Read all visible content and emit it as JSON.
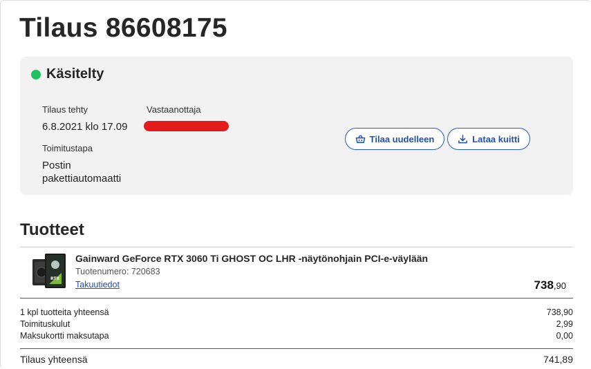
{
  "order": {
    "title": "Tilaus 86608175",
    "status": "Käsitelty",
    "status_color": "#1ec063",
    "ordered_label": "Tilaus tehty",
    "ordered_value": "6.8.2021 klo 17.09",
    "recipient_label": "Vastaanottaja",
    "delivery_label": "Toimitustapa",
    "delivery_value_line1": "Postin",
    "delivery_value_line2": "pakettiautomaatti"
  },
  "actions": {
    "reorder_label": "Tilaa uudelleen",
    "reorder_icon": "basket-icon",
    "receipt_label": "Lataa kuitti",
    "receipt_icon": "download-icon"
  },
  "products": {
    "heading": "Tuotteet",
    "items": [
      {
        "name": "Gainward GeForce RTX 3060 Ti GHOST OC LHR -näytönohjain PCI-e-väylään",
        "product_number": "Tuotenumero: 720683",
        "warranty_link": "Takuutiedot",
        "price_whole": "738",
        "price_cents": ",90"
      }
    ]
  },
  "summary": {
    "rows": [
      {
        "label": "1 kpl tuotteita yhteensä",
        "value": "738,90"
      },
      {
        "label": "Toimituskulut",
        "value": "2,99"
      },
      {
        "label": "Maksukortti maksutapa",
        "value": "0,00"
      }
    ],
    "total_label": "Tilaus yhteensä",
    "total_value": "741,89"
  },
  "colors": {
    "accent": "#1f4fb4",
    "card_bg": "#f2f2f2",
    "redaction": "#e21b1b"
  }
}
